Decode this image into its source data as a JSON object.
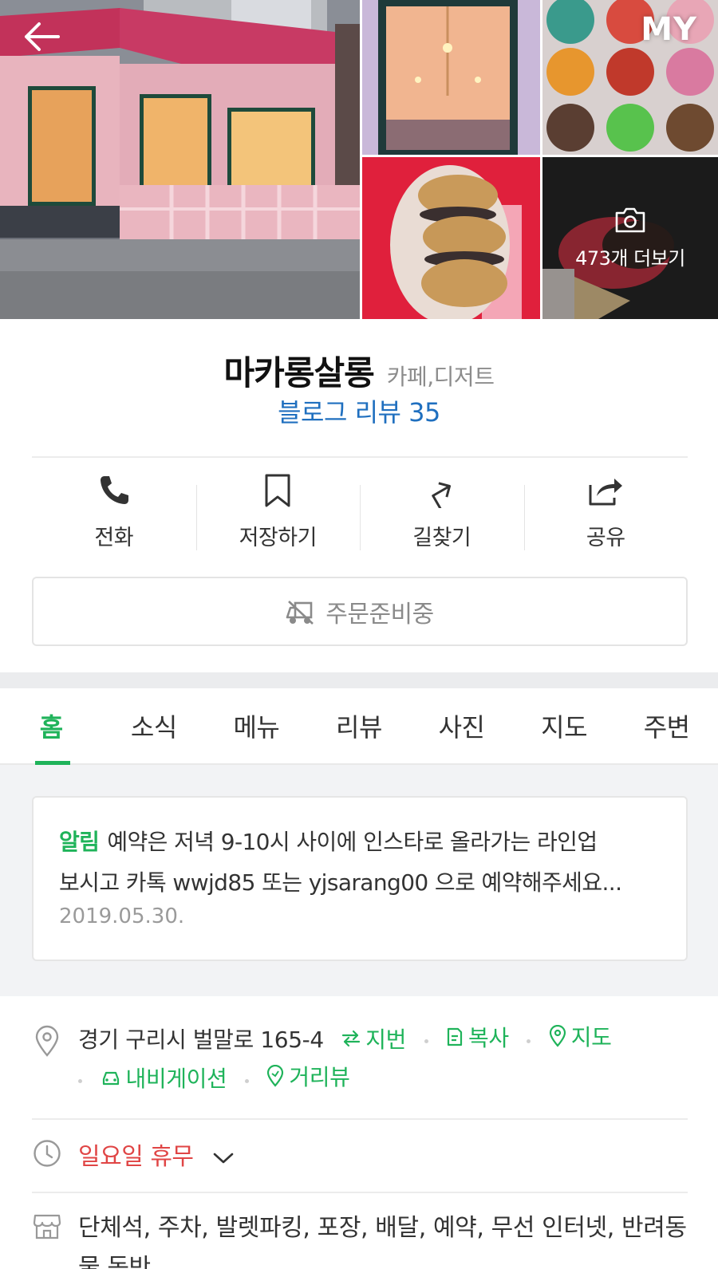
{
  "header": {
    "my_label": "MY",
    "photo_more_label": "473개 더보기"
  },
  "place": {
    "name": "마카롱살롱",
    "category": "카페,디저트",
    "blog_review": "블로그 리뷰 35"
  },
  "actions": [
    {
      "label": "전화",
      "icon": "phone-icon"
    },
    {
      "label": "저장하기",
      "icon": "bookmark-icon"
    },
    {
      "label": "길찾기",
      "icon": "directions-icon"
    },
    {
      "label": "공유",
      "icon": "share-icon"
    }
  ],
  "order": {
    "label": "주문준비중",
    "icon": "delivery-truck-icon"
  },
  "tabs": [
    {
      "label": "홈",
      "active": true
    },
    {
      "label": "소식",
      "active": false
    },
    {
      "label": "메뉴",
      "active": false
    },
    {
      "label": "리뷰",
      "active": false
    },
    {
      "label": "사진",
      "active": false
    },
    {
      "label": "지도",
      "active": false
    },
    {
      "label": "주변",
      "active": false
    }
  ],
  "notice": {
    "tag": "알림",
    "text_line1": "예약은 저녁 9-10시 사이에 인스타로 올라가는 라인업",
    "text_line2": "보시고 카톡 wwjd85 또는 yjsarang00 으로 예약해주세요...",
    "date": "2019.05.30."
  },
  "address": {
    "text": "경기 구리시 벌말로 165-4",
    "links": {
      "jibun": "지번",
      "copy": "복사",
      "map": "지도",
      "navigation": "내비게이션",
      "street_view": "거리뷰"
    }
  },
  "hours": {
    "text": "일요일 휴무"
  },
  "amenities": {
    "text": "단체석, 주차, 발렛파킹, 포장, 배달, 예약, 무선 인터넷, 반려동물 동반"
  },
  "colors": {
    "accent": "#1fb35a",
    "link_blue": "#1f6fbf",
    "closed_red": "#e04545"
  }
}
